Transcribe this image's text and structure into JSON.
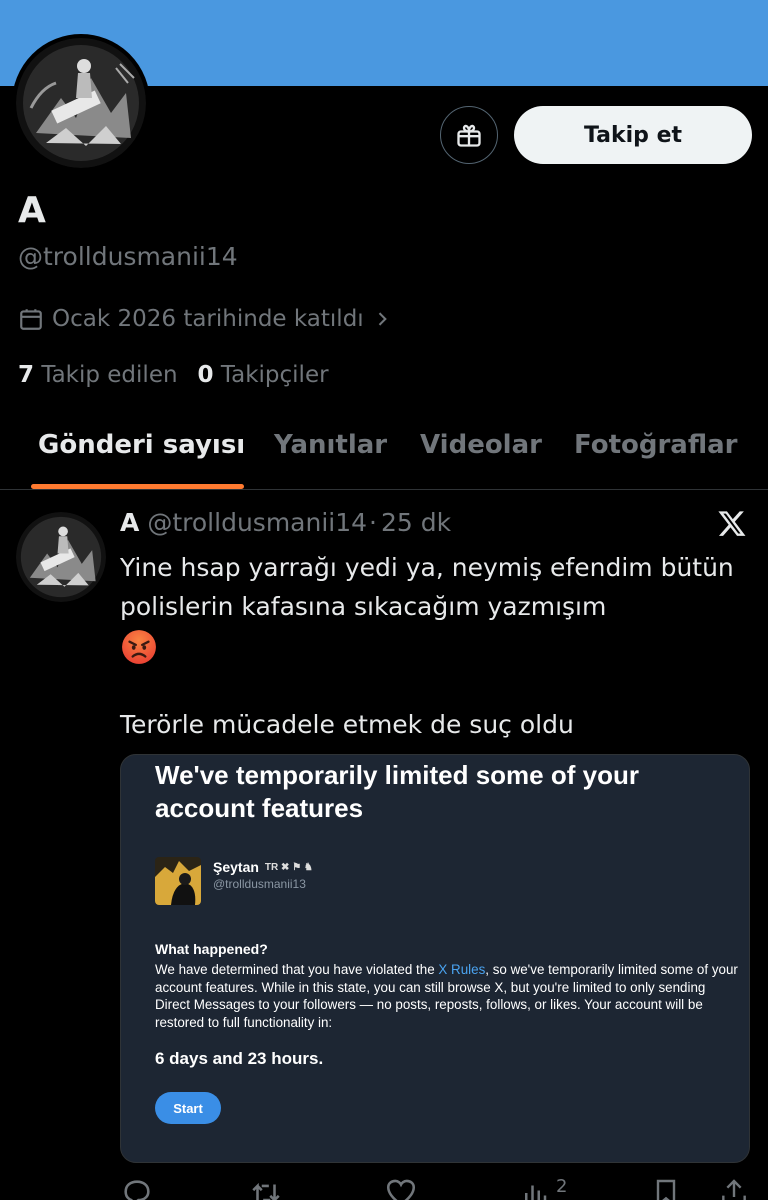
{
  "profile": {
    "display_name": "A",
    "handle": "@trolldusmanii14",
    "joined": "Ocak 2026 tarihinde katıldı",
    "following_count": "7",
    "following_label": "Takip edilen",
    "followers_count": "0",
    "followers_label": "Takipçiler",
    "follow_button": "Takip et",
    "banner_color": "#4a98e0"
  },
  "tabs": [
    {
      "label": "Gönderi sayısı",
      "active": true
    },
    {
      "label": "Yanıtlar",
      "active": false
    },
    {
      "label": "Videolar",
      "active": false
    },
    {
      "label": "Fotoğraflar",
      "active": false
    }
  ],
  "tweet": {
    "name": "A",
    "handle": "@trolldusmanii14",
    "separator": "·",
    "time": "25 dk",
    "line1": "Yine hsap yarrağı yedi ya, neymiş efendim bütün polislerin kafasına sıkacağım yazmışım",
    "emoji": "angry-face-emoji",
    "line2": "Terörle mücadele etmek de suç oldu",
    "media": {
      "title": "We've temporarily limited some of your account features",
      "user_name": "Şeytan",
      "user_flags": "TR ✖ ⚑ ♞",
      "user_handle": "@trolldusmanii13",
      "what_happened": "What happened?",
      "body_before_link": "We have determined that you have violated the ",
      "link": "X Rules",
      "body_after_link": ", so we've temporarily limited some of your account features. While in this state, you can still browse X, but you're limited to only sending Direct Messages to your followers — no posts, reposts, follows, or likes. Your account will be restored to full functionality in:",
      "countdown": "6 days and 23 hours.",
      "start_button": "Start"
    },
    "views": "2"
  },
  "colors": {
    "accent_underline": "#ff7a30",
    "muted_text": "#71767b",
    "link_blue": "#4aa3f0"
  }
}
